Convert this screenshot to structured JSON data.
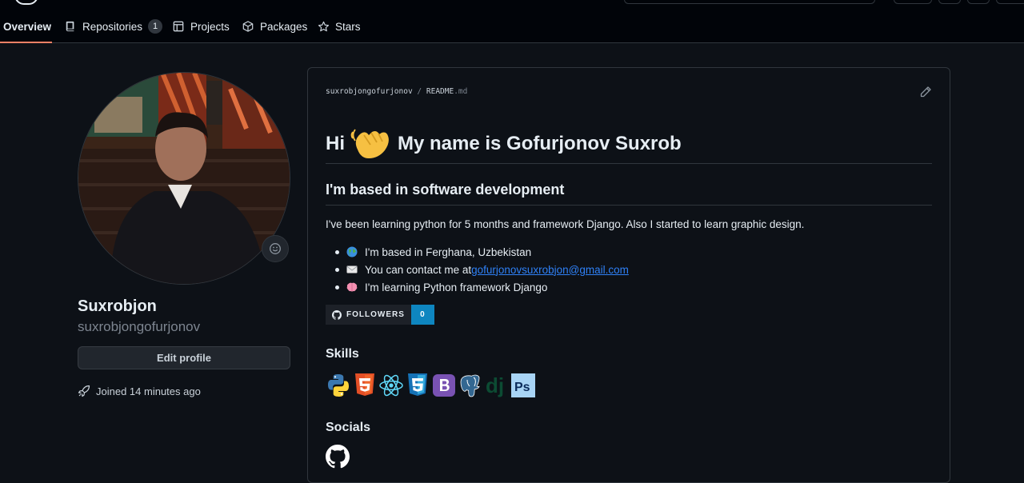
{
  "nav": {
    "tabs": [
      {
        "label": "Overview",
        "icon": "book-icon",
        "active": true
      },
      {
        "label": "Repositories",
        "icon": "repo-icon",
        "count": "1"
      },
      {
        "label": "Projects",
        "icon": "table-icon"
      },
      {
        "label": "Packages",
        "icon": "package-icon"
      },
      {
        "label": "Stars",
        "icon": "star-icon"
      }
    ]
  },
  "profile": {
    "full_name": "Suxrobjon",
    "username": "suxrobjongofurjonov",
    "edit_button": "Edit profile",
    "joined": "Joined 14 minutes ago"
  },
  "readme": {
    "path_owner": "suxrobjongofurjonov",
    "path_sep": "/",
    "path_file": "README",
    "path_ext": ".md",
    "h1_hi": "Hi",
    "h1_rest": "My name is Gofurjonov Suxrob",
    "h2": "I'm based in software development",
    "paragraph": "I've been learning python for 5 months and framework Django. Also I started to learn graphic design.",
    "bullets": [
      {
        "icon": "globe-icon",
        "text": "I'm based in Ferghana, Uzbekistan"
      },
      {
        "icon": "envelope-icon",
        "text": "You can contact me at ",
        "link": "gofurjonovsuxrobjon@gmail.com"
      },
      {
        "icon": "brain-icon",
        "text": "I'm learning Python framework Django"
      }
    ],
    "badge": {
      "label": "FOLLOWERS",
      "count": "0"
    },
    "skills_heading": "Skills",
    "skills": [
      "python",
      "html5",
      "react",
      "css3",
      "bootstrap",
      "postgresql",
      "django",
      "photoshop"
    ],
    "socials_heading": "Socials"
  },
  "colors": {
    "bg": "#0d1117",
    "accent_underline": "#f78166",
    "link": "#2f81f7",
    "badge_right": "#0e86c0"
  }
}
